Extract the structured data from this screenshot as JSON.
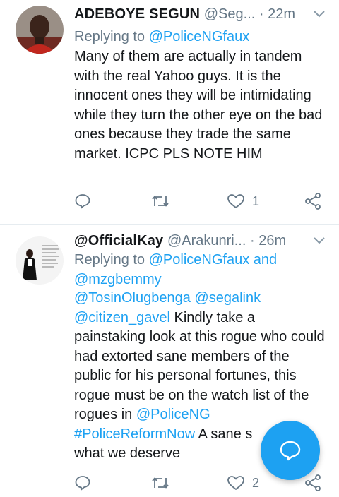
{
  "tweets": [
    {
      "name": "ADEBOYE SEGUN",
      "handle": "@Seg...",
      "dot": "·",
      "time": "22m",
      "replying_prefix": "Replying to ",
      "replying_to": "@PoliceNGfaux",
      "text": "Many of them are actually in tandem with the real Yahoo guys. It is the innocent ones they will be intimidating while they turn the other eye on the bad ones because they trade the same market. ICPC PLS NOTE HIM",
      "reply_count": "",
      "retweet_count": "",
      "like_count": "1"
    },
    {
      "name": "@OfficialKay",
      "handle": "@Arakunri...",
      "dot": "·",
      "time": "26m",
      "replying_prefix": "Replying to ",
      "replying_to_1": "@PoliceNGfaux",
      "replying_and": " and",
      "replying_to_2": "@mzgbemmy",
      "mention_1": "@TosinOlugbenga",
      "mention_2": "@segalink",
      "mention_3": "@citizen_gavel",
      "text_1": " Kindly take a painstaking look at this rogue who could had extorted sane members of the public for his personal fortunes, this rogue must be on the watch list of the rogues in ",
      "mention_4": "@PoliceNG",
      "hashtag": "#PoliceReformNow",
      "text_2": " A sane s",
      "text_3": "what we deserve",
      "like_count": "2"
    }
  ],
  "colors": {
    "link": "#1da1f2",
    "secondary": "#657786",
    "fab": "#1da1f2"
  },
  "icons": [
    "chevron-down-icon",
    "reply-icon",
    "retweet-icon",
    "like-icon",
    "share-icon",
    "compose-reply-icon"
  ]
}
